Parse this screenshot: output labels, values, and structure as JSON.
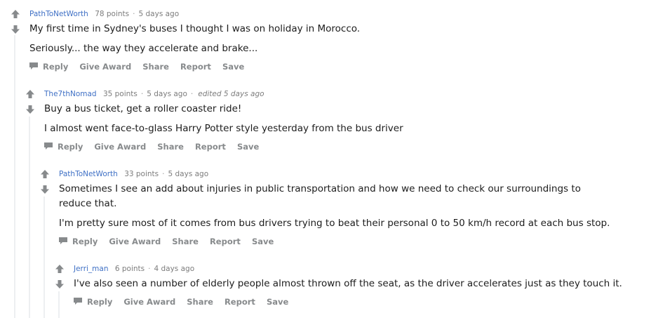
{
  "colors": {
    "author": "#3f70c5",
    "meta": "#7c7c7c",
    "arrow": "#878a8c",
    "thread_line": "#edeff1",
    "action": "#878a8c"
  },
  "actions": {
    "reply": "Reply",
    "give_award": "Give Award",
    "share": "Share",
    "report": "Report",
    "save": "Save"
  },
  "comments": [
    {
      "author": "PathToNetWorth",
      "points": "78 points",
      "time": "5 days ago",
      "edited": "",
      "paragraphs": [
        "My first time in Sydney's buses I thought I was on holiday in Morocco.",
        "Seriously... the way they accelerate and brake..."
      ]
    },
    {
      "author": "The7thNomad",
      "points": "35 points",
      "time": "5 days ago",
      "edited": "edited 5 days ago",
      "paragraphs": [
        "Buy a bus ticket, get a roller coaster ride!",
        "I almost went face-to-glass Harry Potter style yesterday from the bus driver"
      ]
    },
    {
      "author": "PathToNetWorth",
      "points": "33 points",
      "time": "5 days ago",
      "edited": "",
      "paragraphs": [
        "Sometimes I see an add about injuries in public transportation and how we need to check our surroundings to reduce that.",
        "I'm pretty sure most of it comes from bus drivers trying to beat their personal 0 to 50 km/h record at each bus stop."
      ]
    },
    {
      "author": "Jerri_man",
      "points": "6 points",
      "time": "4 days ago",
      "edited": "",
      "paragraphs": [
        "I've also seen a number of elderly people almost thrown off the seat, as the driver accelerates just as they touch it."
      ]
    }
  ]
}
